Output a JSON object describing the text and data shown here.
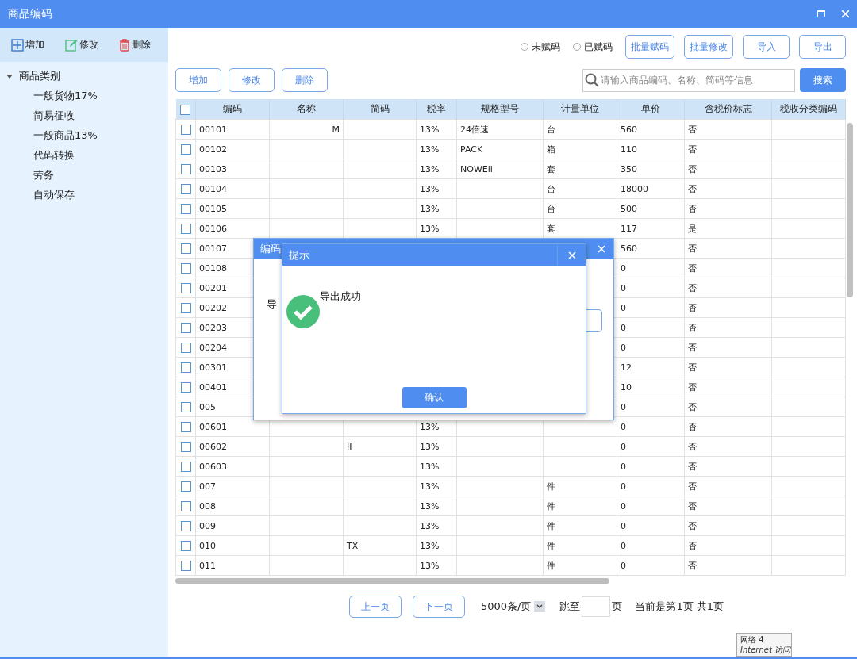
{
  "window": {
    "title": "商品编码"
  },
  "sidebar": {
    "toolbar": [
      {
        "kind": "add",
        "label": "增加"
      },
      {
        "kind": "edit",
        "label": "修改"
      },
      {
        "kind": "delete",
        "label": "删除"
      }
    ],
    "tree": [
      {
        "label": "商品类别",
        "expanded": true,
        "children": [
          {
            "label": "一般货物17%"
          },
          {
            "label": "简易征收"
          },
          {
            "label": "一般商品13%"
          },
          {
            "label": "代码转换"
          },
          {
            "label": "劳务"
          },
          {
            "label": "自动保存"
          }
        ]
      }
    ]
  },
  "filters": [
    {
      "label": "未赋码",
      "selected": false
    },
    {
      "label": "已赋码",
      "selected": false
    }
  ],
  "top_buttons": [
    "批量赋码",
    "批量修改",
    "导入",
    "导出"
  ],
  "actions": [
    "增加",
    "修改",
    "删除"
  ],
  "search": {
    "placeholder": "请输入商品编码、名称、简码等信息",
    "button": "搜索"
  },
  "table": {
    "all_checked": false,
    "columns": [
      "编码",
      "名称",
      "简码",
      "税率",
      "规格型号",
      "计量单位",
      "单价",
      "含税价标志",
      "税收分类编码"
    ],
    "rows": [
      {
        "checked": false,
        "code": "00101",
        "name": "M",
        "tax": "13%",
        "spec": "24倍速",
        "unit": "台",
        "price": "560",
        "flag": "否"
      },
      {
        "checked": false,
        "code": "00102",
        "tax": "13%",
        "spec": "PACK",
        "unit": "箱",
        "price": "110",
        "flag": "否"
      },
      {
        "checked": false,
        "code": "00103",
        "tax": "13%",
        "spec": "NOWEll",
        "unit": "套",
        "price": "350",
        "flag": "否"
      },
      {
        "checked": false,
        "code": "00104",
        "tax": "13%",
        "unit": "台",
        "price": "18000",
        "flag": "否"
      },
      {
        "checked": false,
        "code": "00105",
        "tax": "13%",
        "unit": "台",
        "price": "500",
        "flag": "否"
      },
      {
        "checked": false,
        "code": "00106",
        "tax": "13%",
        "unit": "套",
        "price": "117",
        "flag": "是"
      },
      {
        "checked": false,
        "code": "00107",
        "price": "560",
        "flag": "否"
      },
      {
        "checked": false,
        "code": "00108",
        "price": "0",
        "flag": "否"
      },
      {
        "checked": false,
        "code": "00201",
        "price": "0",
        "flag": "否"
      },
      {
        "checked": false,
        "code": "00202",
        "price": "0",
        "flag": "否"
      },
      {
        "checked": false,
        "code": "00203",
        "price": "0",
        "flag": "否"
      },
      {
        "checked": false,
        "code": "00204",
        "price": "0",
        "flag": "否"
      },
      {
        "checked": false,
        "code": "00301",
        "price": "12",
        "flag": "否"
      },
      {
        "checked": false,
        "code": "00401",
        "price": "10",
        "flag": "否"
      },
      {
        "checked": false,
        "code": "005",
        "price": "0",
        "flag": "否"
      },
      {
        "checked": false,
        "code": "00601",
        "tax": "13%",
        "price": "0",
        "flag": "否"
      },
      {
        "checked": false,
        "code": "00602",
        "short": "II",
        "tax": "13%",
        "price": "0",
        "flag": "否"
      },
      {
        "checked": false,
        "code": "00603",
        "tax": "13%",
        "price": "0",
        "flag": "否"
      },
      {
        "checked": false,
        "code": "007",
        "tax": "13%",
        "unit": "件",
        "price": "0",
        "flag": "否"
      },
      {
        "checked": false,
        "code": "008",
        "tax": "13%",
        "unit": "件",
        "price": "0",
        "flag": "否"
      },
      {
        "checked": false,
        "code": "009",
        "tax": "13%",
        "unit": "件",
        "price": "0",
        "flag": "否"
      },
      {
        "checked": false,
        "code": "010",
        "short": "TX",
        "tax": "13%",
        "unit": "件",
        "price": "0",
        "flag": "否"
      },
      {
        "checked": false,
        "code": "011",
        "tax": "13%",
        "unit": "件",
        "price": "0",
        "flag": "否"
      }
    ]
  },
  "pager": {
    "prev": "上一页",
    "next": "下一页",
    "page_size": "5000条/页",
    "jump_label": "跳至",
    "page_unit": "页",
    "status": "当前是第1页 共1页"
  },
  "back_dialog": {
    "title": "编码",
    "label_1": "导"
  },
  "dialog": {
    "title": "提示",
    "message": "导出成功",
    "button": "确认"
  },
  "tooltip": {
    "line_1": "网络  4",
    "line_2": "Internet 访问"
  }
}
